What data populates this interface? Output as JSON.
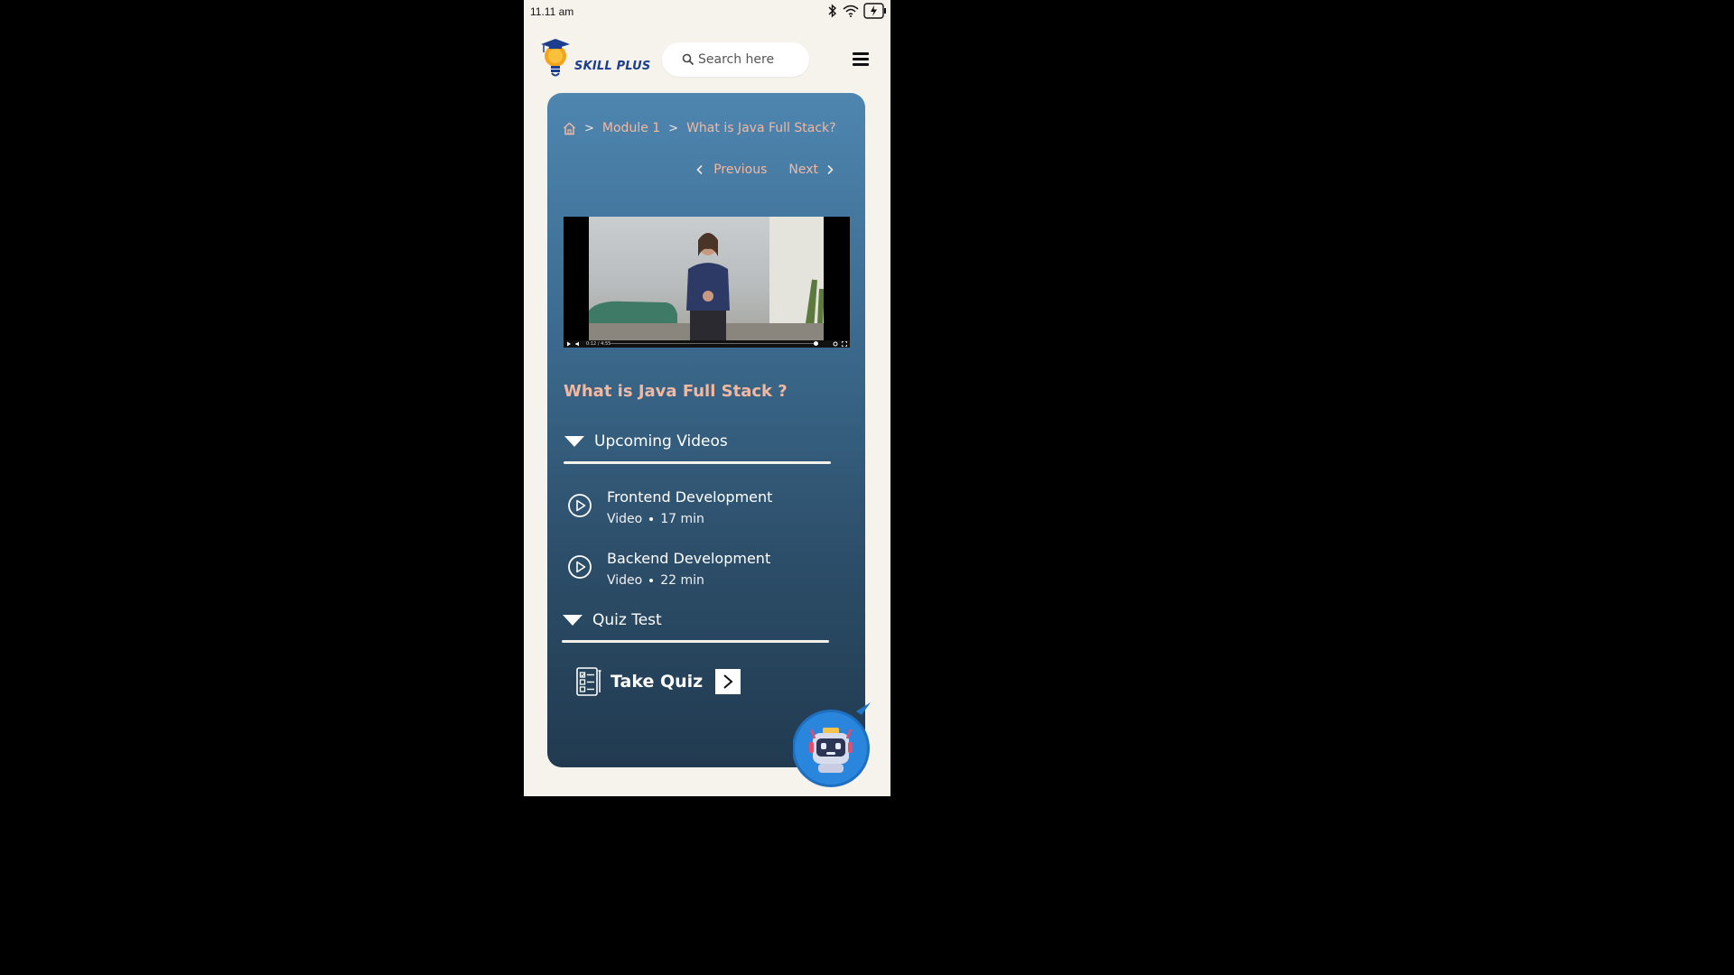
{
  "status": {
    "time": "11.11 am"
  },
  "brand": {
    "name": "SKILL PLUS"
  },
  "search": {
    "placeholder": "Search here"
  },
  "breadcrumb": {
    "module": "Module 1",
    "current": "What is Java Full Stack?"
  },
  "pager": {
    "previous": "Previous",
    "next": "Next"
  },
  "lesson": {
    "title": "What is Java Full Stack ?",
    "video_time": "0:12 / 4:55"
  },
  "upcoming": {
    "heading": "Upcoming Videos",
    "items": [
      {
        "title": "Frontend Development",
        "type": "Video",
        "duration": "17 min"
      },
      {
        "title": "Backend Development",
        "type": "Video",
        "duration": "22 min"
      }
    ]
  },
  "quiz": {
    "heading": "Quiz Test",
    "action": "Take Quiz"
  },
  "colors": {
    "accent": "#f2b8a0",
    "card_top": "#4e86b0",
    "card_bottom": "#213a50",
    "brand": "#1d3d8f"
  }
}
